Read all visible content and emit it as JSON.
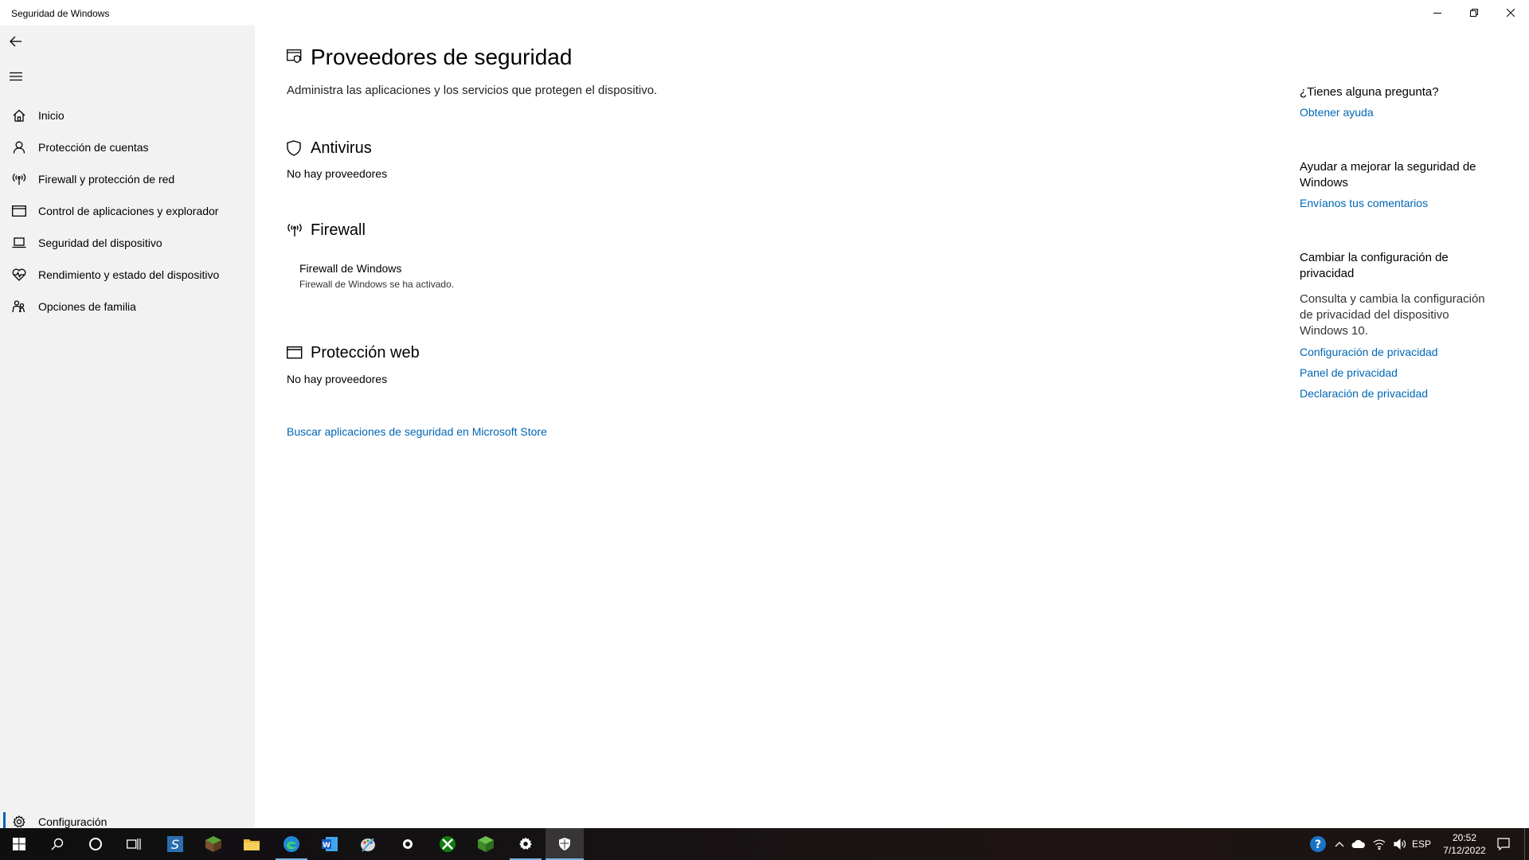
{
  "window": {
    "title": "Seguridad de Windows"
  },
  "sidebar": {
    "items": [
      {
        "label": "Inicio",
        "icon": "home-icon"
      },
      {
        "label": "Protección de cuentas",
        "icon": "person-icon"
      },
      {
        "label": "Firewall y protección de red",
        "icon": "antenna-icon"
      },
      {
        "label": "Control de aplicaciones y explorador",
        "icon": "browser-window-icon"
      },
      {
        "label": "Seguridad del dispositivo",
        "icon": "laptop-icon"
      },
      {
        "label": "Rendimiento y estado del dispositivo",
        "icon": "heart-pulse-icon"
      },
      {
        "label": "Opciones de familia",
        "icon": "family-icon"
      }
    ],
    "settings_label": "Configuración"
  },
  "main": {
    "title": "Proveedores de seguridad",
    "subtitle": "Administra las aplicaciones y los servicios que protegen el dispositivo.",
    "sections": {
      "antivirus": {
        "title": "Antivirus",
        "text": "No hay proveedores"
      },
      "firewall": {
        "title": "Firewall",
        "provider_name": "Firewall de Windows",
        "provider_status": "Firewall de Windows se ha activado."
      },
      "web": {
        "title": "Protección web",
        "text": "No hay proveedores"
      }
    },
    "store_link": "Buscar aplicaciones de seguridad en Microsoft Store"
  },
  "right": {
    "question_heading": "¿Tienes alguna pregunta?",
    "help_link": "Obtener ayuda",
    "improve_heading": "Ayudar a mejorar la seguridad de Windows",
    "feedback_link": "Envíanos tus comentarios",
    "privacy_heading": "Cambiar la configuración de privacidad",
    "privacy_text": "Consulta y cambia la configuración de privacidad del dispositivo Windows 10.",
    "privacy_links": [
      "Configuración de privacidad",
      "Panel de privacidad",
      "Declaración de privacidad"
    ]
  },
  "taskbar": {
    "language": "ESP",
    "time": "20:52",
    "date": "7/12/2022"
  },
  "colors": {
    "link": "#0066b4",
    "sidebar_bg": "#f2f2f2",
    "accent": "#0063b1"
  }
}
